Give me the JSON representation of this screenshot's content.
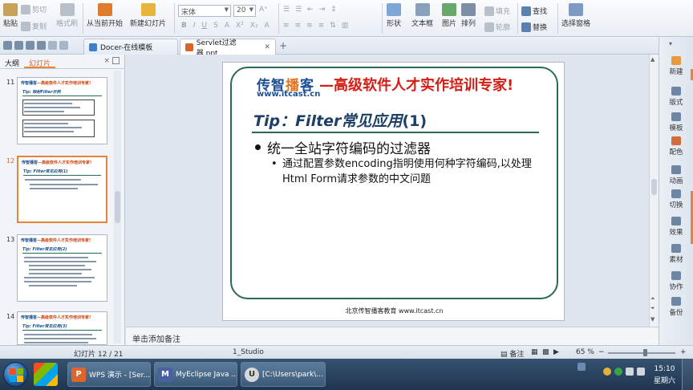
{
  "ribbon": {
    "paste": "粘贴",
    "cut": "剪切",
    "copy": "复制",
    "format_painter": "格式刷",
    "from_current": "从当前开始",
    "new_slide": "新建幻灯片",
    "font_name": "宋体",
    "font_size": "20",
    "shapes": "形状",
    "textbox": "文本框",
    "picture": "图片",
    "arrange": "排列",
    "fill": "填充",
    "outline": "轮廓",
    "find": "查找",
    "replace": "替换",
    "select_pane": "选择窗格"
  },
  "tabs": [
    {
      "label": "Docer-在线模板"
    },
    {
      "label": "Servlet过滤器.ppt"
    }
  ],
  "left_panel": {
    "tab_outline": "大纲",
    "tab_slides": "幻灯片",
    "close": "×",
    "thumbs": [
      {
        "num": "11",
        "title_a": "传智播客",
        "title_b": "—高级软件人才实作培训专家!",
        "sub": "Tip: 映射Filter示例"
      },
      {
        "num": "12",
        "title_a": "传智播客",
        "title_b": "—高级软件人才实作培训专家!",
        "sub": "Tip: Filter常见应用(1)"
      },
      {
        "num": "13",
        "title_a": "传智播客",
        "title_b": "—高级软件人才实作培训专家!",
        "sub": "Tip: Filter常见应用(2)"
      },
      {
        "num": "14",
        "title_a": "传智播客",
        "title_b": "—高级软件人才实作培训专家!",
        "sub": "Tip: Filter常见应用(3)"
      }
    ]
  },
  "slide": {
    "logo_a": "传智",
    "logo_b": "播",
    "logo_c": "客",
    "logo_url": "www.itcast.cn",
    "tagline": "—高级软件人才实作培训专家!",
    "title_latin": "Tip：Filter",
    "title_cn": "常见应用",
    "title_num": "(1)",
    "bullet1": "统一全站字符编码的过滤器",
    "bullet2": "通过配置参数encoding指明使用何种字符编码,以处理Html Form请求参数的中文问题",
    "footer": "北京传智播客教育 www.itcast.cn"
  },
  "notes": {
    "placeholder": "单击添加备注"
  },
  "right_pane": {
    "items": [
      "新建",
      "版式",
      "模板",
      "配色",
      "动画",
      "切换",
      "效果",
      "素材",
      "协作",
      "备份"
    ]
  },
  "status": {
    "slide_info": "幻灯片 12 / 21",
    "theme": "1_Studio",
    "notes_btn": "备注",
    "zoom": "65 %",
    "zoom_fraction": 0.55
  },
  "taskbar": {
    "tasks": [
      {
        "label": "WPS 演示 - [Ser..."
      },
      {
        "label": "MyEclipse Java ..."
      },
      {
        "label": "[C:\\Users\\park\\..."
      }
    ],
    "time": "15:10",
    "day": "星期六"
  },
  "colors": {
    "accent": "#e8833a",
    "slide_frame": "#2a6b58",
    "tagline": "#d41e16",
    "logo": "#1c4f96"
  }
}
